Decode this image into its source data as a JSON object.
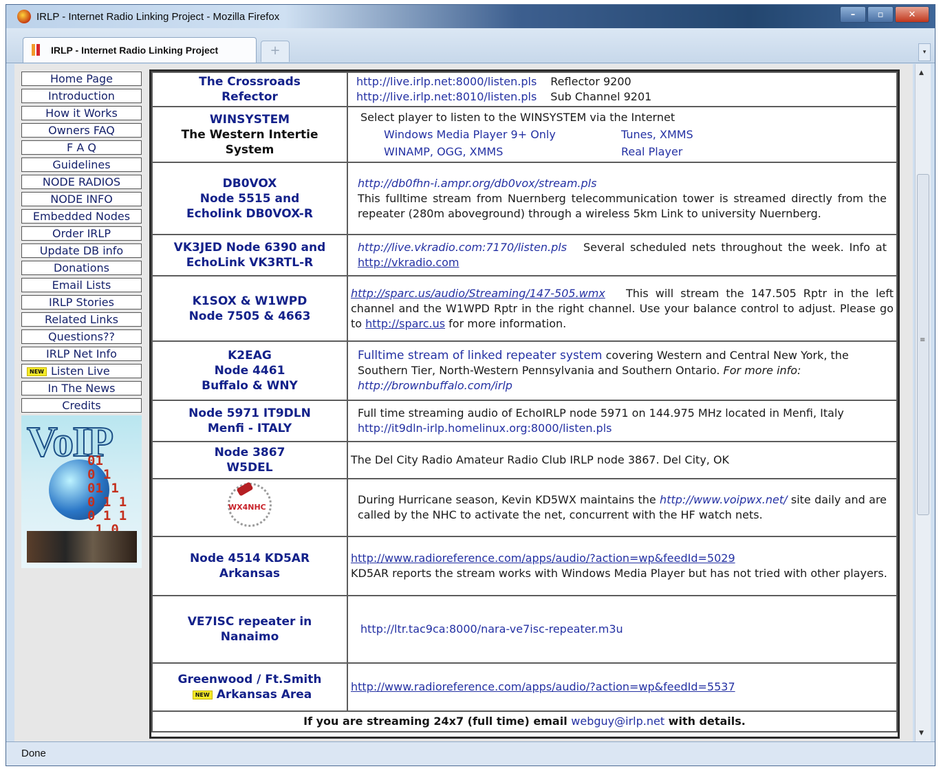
{
  "window": {
    "title": "IRLP - Internet Radio Linking Project - Mozilla Firefox",
    "minimize": "–",
    "maximize": "▫",
    "close": "✕"
  },
  "tabs": {
    "active_label": "IRLP - Internet Radio Linking Project",
    "new_tab": "+"
  },
  "sidebar": {
    "items": [
      {
        "label": "Home Page"
      },
      {
        "label": "Introduction"
      },
      {
        "label": "How it Works"
      },
      {
        "label": "Owners FAQ"
      },
      {
        "label": "F A Q"
      },
      {
        "label": "Guidelines"
      },
      {
        "label": "NODE RADIOS"
      },
      {
        "label": "NODE INFO"
      },
      {
        "label": "Embedded Nodes"
      },
      {
        "label": "Order IRLP"
      },
      {
        "label": "Update DB info"
      },
      {
        "label": "Donations"
      },
      {
        "label": "Email Lists"
      },
      {
        "label": "IRLP Stories"
      },
      {
        "label": "Related Links"
      },
      {
        "label": "Questions??"
      },
      {
        "label": "IRLP Net Info"
      },
      {
        "label": "Listen Live",
        "badge": "NEW"
      },
      {
        "label": "In The News"
      },
      {
        "label": "Credits"
      }
    ],
    "banner": {
      "logo_text": "VoIP",
      "binary": "01\n0 1\n01 1\n0 1 1\n0 1 1\n 1 0"
    }
  },
  "streams": [
    {
      "name": "The Crossroads\nRefector",
      "url1": "http://live.irlp.net:8000/listen.pls",
      "desc1": "Reflector 9200",
      "url2": "http://live.irlp.net:8010/listen.pls",
      "desc2": "Sub Channel 9201"
    },
    {
      "name_line1": "WINSYSTEM",
      "name_line2": "The Western Intertie\nSystem",
      "intro": "Select player to listen to the WINSYSTEM via the Internet",
      "players": [
        "Windows Media Player 9+ Only",
        "Tunes, XMMS",
        "WINAMP, OGG, XMMS",
        "Real Player"
      ]
    },
    {
      "name": "DB0VOX\nNode 5515 and\nEcholink DB0VOX-R",
      "url": "http://db0fhn-i.ampr.org/db0vox/stream.pls",
      "text": "This fulltime stream from Nuernberg telecommunication tower is streamed directly from the repeater (280m aboveground) through a wireless 5km Link to university Nuernberg."
    },
    {
      "name": "VK3JED Node 6390 and\nEchoLink VK3RTL-R",
      "url": "http://live.vkradio.com:7170/listen.pls",
      "text_a": "Several scheduled nets throughout the week.  Info at",
      "link": "http://vkradio.com"
    },
    {
      "name": "K1SOX & W1WPD\nNode 7505 & 4663",
      "url": "http://sparc.us/audio/Streaming/147-505.wmx",
      "text_a": "This will stream the 147.505 Rptr in the left channel and the W1WPD Rptr in the right channel.  Use your balance control to adjust. Please go to",
      "link": "http://sparc.us",
      "text_b": "for more information."
    },
    {
      "name": "K2EAG\nNode 4461\nBuffalo & WNY",
      "lead": "Fulltime stream of linked repeater system",
      "text": "covering Western and Central New York, the Southern Tier, North-Western Pennsylvania and Southern Ontario.",
      "more": "For more info:",
      "url": "http://brownbuffalo.com/irlp"
    },
    {
      "name": "Node 5971 IT9DLN\nMenfi - ITALY",
      "text": "Full time streaming audio of EchoIRLP node 5971 on 144.975 MHz located in Menfi, Italy",
      "url": "http://it9dln-irlp.homelinux.org:8000/listen.pls"
    },
    {
      "name": "Node 3867\nW5DEL",
      "text": "The Del City Radio Amateur Radio Club IRLP node 3867.  Del City, OK"
    },
    {
      "logo_text": "WX4NHC",
      "text_a": "During Hurricane season, Kevin KD5WX maintains the",
      "url": "http://www.voipwx.net/",
      "text_b": "site daily and are called by the NHC to activate the net, concurrent with the HF watch nets."
    },
    {
      "name": "Node 4514 KD5AR\nArkansas",
      "url": "http://www.radioreference.com/apps/audio/?action=wp&feedId=5029",
      "text": "KD5AR reports the stream works with Windows Media Player but has not tried with other players."
    },
    {
      "name": "VE7ISC repeater in\nNanaimo",
      "url": "http://ltr.tac9ca:8000/nara-ve7isc-repeater.m3u"
    },
    {
      "name_line1": "Greenwood / Ft.Smith",
      "badge": "NEW",
      "name_line2": "Arkansas Area",
      "url": "http://www.radioreference.com/apps/audio/?action=wp&feedId=5537"
    }
  ],
  "footer": {
    "text_a": "If you are streaming 24x7 (full time) email",
    "email": "webguy@irlp.net",
    "text_b": "with details."
  },
  "status": {
    "text": "Done"
  },
  "scrollbar": {
    "up": "▲",
    "down": "▼",
    "grip": "≡"
  }
}
